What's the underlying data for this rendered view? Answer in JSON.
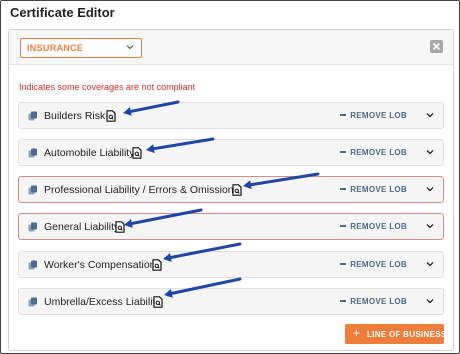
{
  "window": {
    "title": "Certificate Editor"
  },
  "toolbar": {
    "select_value": "INSURANCE"
  },
  "notice": "Indicates some coverages are not compliant",
  "lobs": [
    {
      "label": "Builders Risk",
      "compliant": true
    },
    {
      "label": "Automobile Liability",
      "compliant": true
    },
    {
      "label": "Professional Liability / Errors & Omissions",
      "compliant": false
    },
    {
      "label": "General Liability",
      "compliant": false
    },
    {
      "label": "Worker's Compensation",
      "compliant": true
    },
    {
      "label": "Umbrella/Excess Liability",
      "compliant": true
    }
  ],
  "remove_label": "REMOVE LOB",
  "add_button": {
    "icon": "+",
    "label": "LINE OF BUSINESS"
  },
  "colors": {
    "accent": "#ef7d3c",
    "error": "#d22d2d",
    "link": "#4e6a8e",
    "arrow": "#1f45a8"
  }
}
